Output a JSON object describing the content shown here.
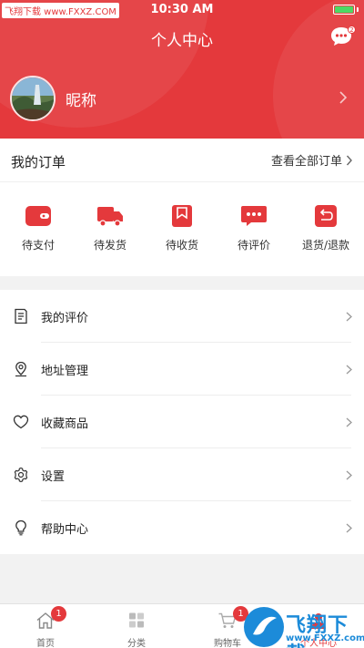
{
  "status_bar": {
    "watermark": "飞翔下载 www.FXXZ.COM",
    "time": "10:30 AM"
  },
  "header": {
    "title": "个人中心",
    "message_badge": "2",
    "nickname": "昵称"
  },
  "orders": {
    "title": "我的订单",
    "view_all": "查看全部订单",
    "items": [
      {
        "label": "待支付",
        "icon": "wallet-icon"
      },
      {
        "label": "待发货",
        "icon": "truck-icon"
      },
      {
        "label": "待收货",
        "icon": "bookmark-box-icon"
      },
      {
        "label": "待评价",
        "icon": "chat-dots-icon"
      },
      {
        "label": "退货/退款",
        "icon": "return-icon"
      }
    ]
  },
  "menu": [
    {
      "label": "我的评价",
      "icon": "document-icon"
    },
    {
      "label": "地址管理",
      "icon": "location-pin-icon"
    },
    {
      "label": "收藏商品",
      "icon": "heart-icon"
    },
    {
      "label": "设置",
      "icon": "gear-icon"
    },
    {
      "label": "帮助中心",
      "icon": "lightbulb-icon"
    }
  ],
  "tabbar": [
    {
      "label": "首页",
      "badge": "1",
      "icon": "home-icon",
      "active": false
    },
    {
      "label": "分类",
      "badge": "",
      "icon": "grid-icon",
      "active": false
    },
    {
      "label": "购物车",
      "badge": "1",
      "icon": "cart-icon",
      "active": false
    },
    {
      "label": "个人中心",
      "badge": "",
      "icon": "user-icon",
      "active": true
    }
  ],
  "watermark": {
    "text": "飞翔下载",
    "url": "www.FXXZ.com"
  },
  "colors": {
    "accent": "#e4393c",
    "background": "#f2f2f2",
    "watermark": "#1c8bd9"
  }
}
